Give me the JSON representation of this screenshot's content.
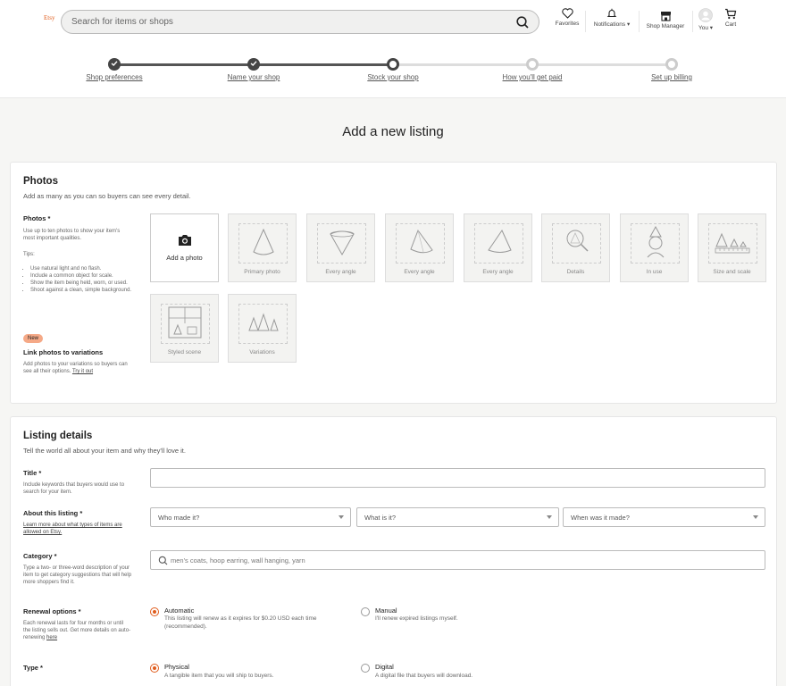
{
  "header": {
    "logo": "Etsy",
    "search_placeholder": "Search for items or shops",
    "nav": {
      "favorites": "Favorites",
      "notifications": "Notifications ▾",
      "shop_manager": "Shop Manager",
      "you": "You ▾",
      "cart": "Cart"
    }
  },
  "stepper": {
    "steps": [
      {
        "label": "Shop preferences",
        "state": "done"
      },
      {
        "label": "Name your shop",
        "state": "done"
      },
      {
        "label": "Stock your shop",
        "state": "current"
      },
      {
        "label": "How you'll get paid",
        "state": "todo"
      },
      {
        "label": "Set up billing",
        "state": "todo"
      }
    ]
  },
  "page_title": "Add a new listing",
  "photos": {
    "title": "Photos",
    "subtitle": "Add as many as you can so buyers can see every detail.",
    "label": "Photos *",
    "help": "Use up to ten photos to show your item's most important qualities.",
    "tips_label": "Tips:",
    "tips": [
      "Use natural light and no flash.",
      "Include a common object for scale.",
      "Show the item being held, worn, or used.",
      "Shoot against a clean, simple background."
    ],
    "badge": "New",
    "link_title": "Link photos to variations",
    "link_help": "Add photos to your variations so buyers can see all their options.",
    "link_try": "Try it out",
    "add_photo": "Add a photo",
    "tiles": [
      "Primary photo",
      "Every angle",
      "Every angle",
      "Every angle",
      "Details",
      "In use",
      "Size and scale",
      "Styled scene",
      "Variations"
    ]
  },
  "details": {
    "title": "Listing details",
    "subtitle": "Tell the world all about your item and why they'll love it.",
    "title_label": "Title *",
    "title_help": "Include keywords that buyers would use to search for your item.",
    "about_label": "About this listing *",
    "about_link": "Learn more about what types of items are allowed on Etsy.",
    "who_made": "Who made it?",
    "what_is": "What is it?",
    "when_made": "When was it made?",
    "category_label": "Category *",
    "category_help": "Type a two- or three-word description of your item to get category suggestions that will help more shoppers find it.",
    "category_placeholder": "men's coats, hoop earring, wall hanging, yarn",
    "renewal_label": "Renewal options *",
    "renewal_help": "Each renewal lasts for four months or until the listing sells out. Get more details on auto-renewing",
    "renewal_here": "here",
    "renewal_auto_title": "Automatic",
    "renewal_auto_desc": "This listing will renew as it expires for $0.20 USD each time (recommended).",
    "renewal_manual_title": "Manual",
    "renewal_manual_desc": "I'll renew expired listings myself.",
    "type_label": "Type *",
    "type_physical_title": "Physical",
    "type_physical_desc": "A tangible item that you will ship to buyers.",
    "type_digital_title": "Digital",
    "type_digital_desc": "A digital file that buyers will download."
  },
  "colors": {
    "accent": "#e05c1c",
    "badge": "#f5a987"
  }
}
